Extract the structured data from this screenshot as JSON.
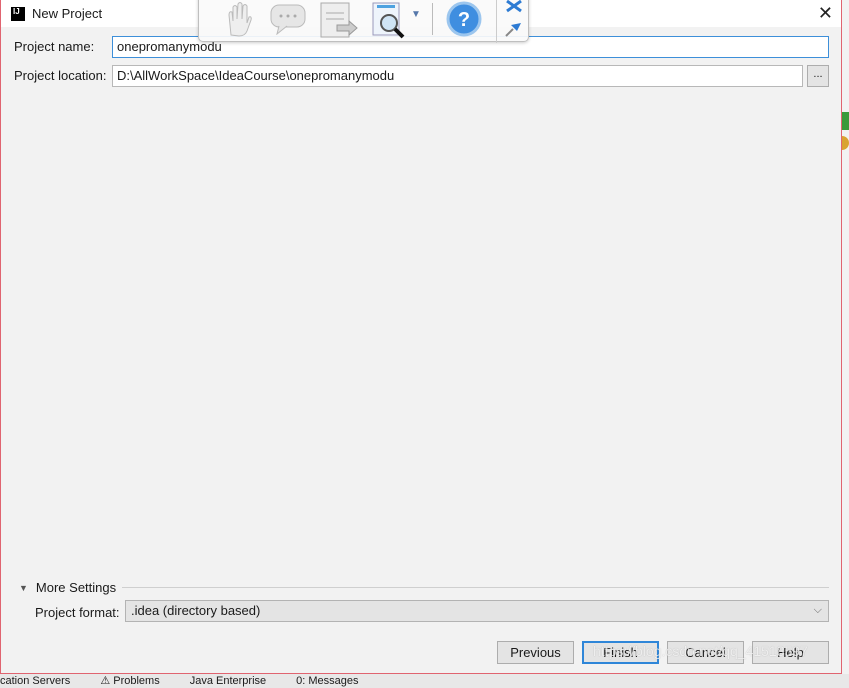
{
  "window": {
    "title": "New Project",
    "logo": "IJ"
  },
  "fields": {
    "project_name_label": "Project name:",
    "project_name_value": "onepromanymodu",
    "project_location_label": "Project location:",
    "project_location_value": "D:\\AllWorkSpace\\IdeaCourse\\onepromanymodu",
    "browse_label": "..."
  },
  "more_settings": {
    "label": "More Settings",
    "format_label": "Project format:",
    "format_value": ".idea (directory based)"
  },
  "buttons": {
    "previous": "Previous",
    "finish": "Finish",
    "cancel": "Cancel",
    "help": "Help"
  },
  "status_bar": [
    "cation Servers",
    "⚠ Problems",
    "Java Enterprise",
    "0: Messages"
  ],
  "toolbar_icons": [
    "hand-icon",
    "comment-icon",
    "export-document-icon",
    "search-document-icon",
    "help-icon",
    "close-icon",
    "pin-icon"
  ],
  "watermark": "https://blog.csdn.net/qq_41518597",
  "colors": {
    "focus": "#3d8fd9",
    "dialog_bg": "#f2f2f2",
    "border": "#e06470"
  }
}
